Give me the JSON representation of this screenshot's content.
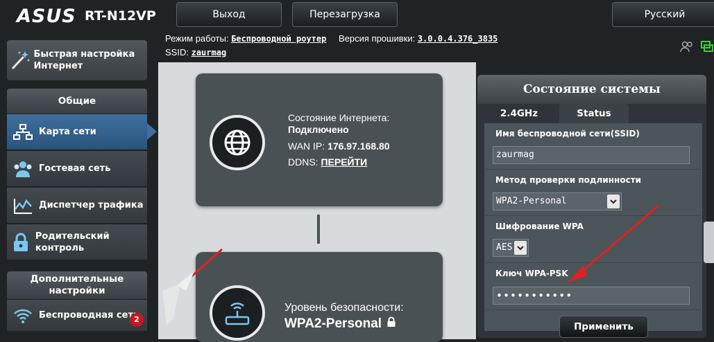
{
  "header": {
    "brand": "ASUS",
    "model": "RT-N12VP",
    "logout_label": "Выход",
    "reboot_label": "Перезагрузка",
    "language": "Русский",
    "mode_label": "Режим работы:",
    "mode_value": "Беспроводной роутер",
    "firmware_label": "Версия прошивки:",
    "firmware_value": "3.0.0.4.376_3835",
    "ssid_label": "SSID:",
    "ssid_value": "zaurmag"
  },
  "sidebar": {
    "quick_setup": "Быстрая настройка Интернет",
    "general_header": "Общие",
    "items": [
      {
        "label": "Карта сети",
        "icon": "network-map-icon",
        "active": true
      },
      {
        "label": "Гостевая сеть",
        "icon": "guest-network-icon"
      },
      {
        "label": "Диспетчер трафика",
        "icon": "traffic-manager-icon"
      },
      {
        "label": "Родительский контроль",
        "icon": "parental-control-icon"
      }
    ],
    "advanced_header": "Дополнительные настройки",
    "wireless_label": "Беспроводная сеть",
    "wireless_badge": "2"
  },
  "map": {
    "internet_status_label": "Состояние Интернета:",
    "internet_status_value": "Подключено",
    "wan_ip_label": "WAN IP:",
    "wan_ip_value": "176.97.168.80",
    "ddns_label": "DDNS:",
    "ddns_link": "ПЕРЕЙТИ",
    "security_label": "Уровень безопасности:",
    "security_value": "WPA2-Personal"
  },
  "status_panel": {
    "title": "Состояние системы",
    "tabs": [
      "2.4GHz",
      "Status"
    ],
    "ssid_label": "Имя беспроводной сети(SSID)",
    "ssid_value": "zaurmag",
    "auth_label": "Метод проверки подлинности",
    "auth_value": "WPA2-Personal",
    "wpa_enc_label": "Шифрование WPA",
    "wpa_enc_value": "AES",
    "psk_label": "Ключ WPA-PSK",
    "psk_value": "•••••••••••",
    "apply_label": "Применить"
  },
  "colors": {
    "accent_active": "#3f6f9e",
    "badge": "#c8171e",
    "annotation_arrow": "#e02020"
  }
}
